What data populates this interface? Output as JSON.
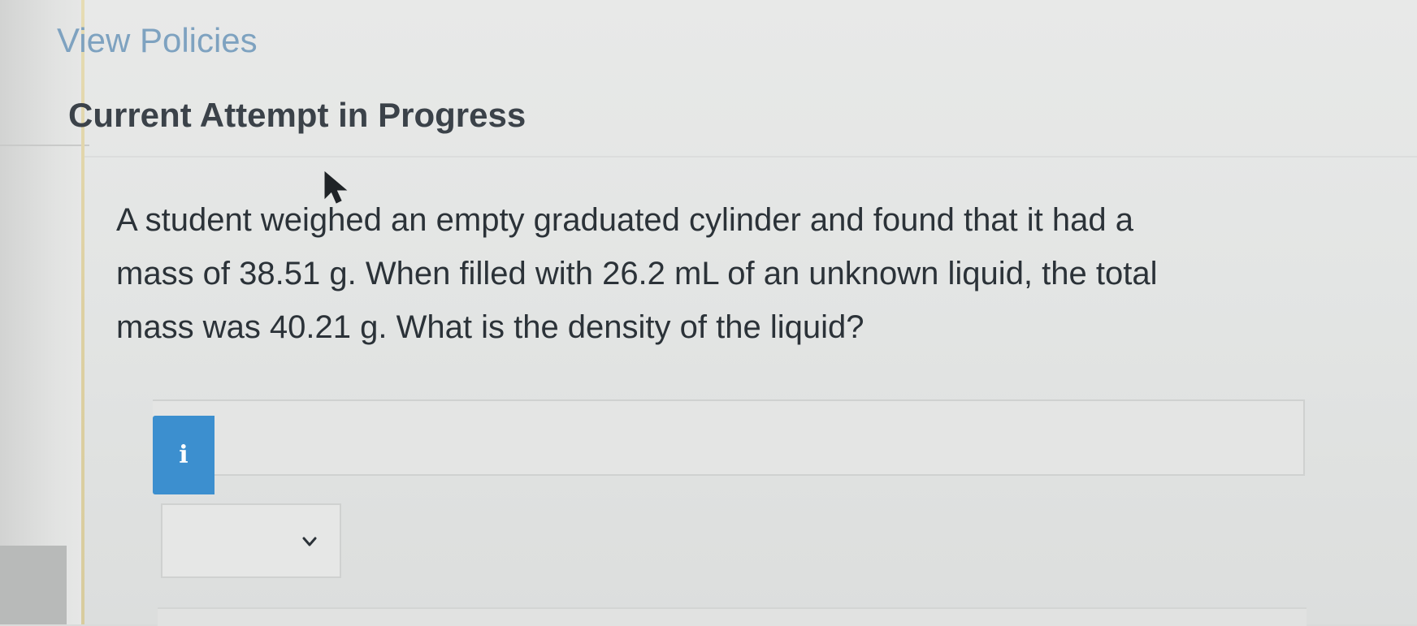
{
  "header": {
    "view_policies_label": "View Policies",
    "attempt_title": "Current Attempt in Progress"
  },
  "question": {
    "lines": [
      "A student weighed an empty graduated cylinder and found that it had a",
      "mass of 38.51 g. When filled with 26.2 mL of an unknown liquid, the total",
      "mass was 40.21 g. What is the density of the liquid?"
    ]
  },
  "answer": {
    "info_icon_glyph": "i",
    "input_value": "",
    "unit_selected": ""
  },
  "icons": {
    "info": "info-icon",
    "dropdown": "chevron-down-icon",
    "cursor": "mouse-pointer-icon"
  },
  "colors": {
    "link": "#7ea2c0",
    "title": "#3b4249",
    "info_button": "#3c8fcf"
  }
}
